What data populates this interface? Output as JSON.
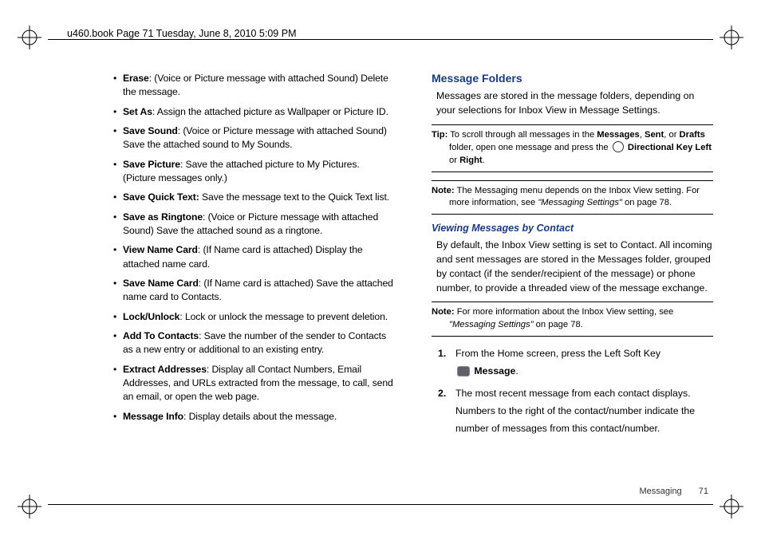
{
  "meta_header": "u460.book  Page 71  Tuesday, June 8, 2010  5:09 PM",
  "left": {
    "items": [
      {
        "term": "Erase",
        "desc": ": (Voice or Picture message with attached Sound) Delete the message."
      },
      {
        "term": "Set As",
        "desc": ": Assign the attached picture as Wallpaper or Picture ID."
      },
      {
        "term": "Save Sound",
        "desc": ": (Voice or Picture message with attached Sound) Save the attached sound to My Sounds."
      },
      {
        "term": "Save Picture",
        "desc": ": Save the attached picture to My Pictures. (Picture messages only.)"
      },
      {
        "term": "Save Quick Text:",
        "desc": " Save the message text to the Quick Text list."
      },
      {
        "term": "Save as Ringtone",
        "desc": ": (Voice or Picture message with attached Sound) Save the attached sound as a ringtone."
      },
      {
        "term": "View Name Card",
        "desc": ": (If Name card is attached) Display the attached name card."
      },
      {
        "term": "Save Name Card",
        "desc": ": (If Name card is attached) Save the attached name card to Contacts."
      },
      {
        "term": "Lock/Unlock",
        "desc": ": Lock or unlock the message to prevent deletion."
      },
      {
        "term": "Add To Contacts",
        "desc": ": Save the number of the sender to Contacts as a new entry or additional to an existing entry."
      },
      {
        "term": "Extract Addresses",
        "desc": ": Display all Contact Numbers, Email Addresses, and URLs extracted from the message, to call, send an email, or open the web page."
      },
      {
        "term": "Message Info",
        "desc": ": Display details about the message."
      }
    ]
  },
  "right": {
    "heading": "Message Folders",
    "intro": "Messages are stored in the message folders, depending on your selections for Inbox View in Message Settings.",
    "tip": {
      "lead": "Tip:",
      "pre": " To scroll through all messages in the ",
      "b1": "Messages",
      "c1": ", ",
      "b2": "Sent",
      "c2": ", or ",
      "b3": "Drafts",
      "mid": " folder, open one message and press the ",
      "b4": "Directional Key Left",
      "c3": " or ",
      "b5": "Right",
      "end": "."
    },
    "note1": {
      "lead": "Note:",
      "text": " The Messaging menu depends on the Inbox View setting. For more information, see ",
      "ref": "\"Messaging Settings\"",
      "tail": " on page 78."
    },
    "sub1": "Viewing Messages by Contact",
    "p1": "By default, the Inbox View setting is set to Contact. All incoming and sent messages are stored in the Messages folder, grouped by contact (if the sender/recipient of the message) or phone number, to provide a threaded view of the message exchange.",
    "note2": {
      "lead": "Note:",
      "text": " For more information about the Inbox View setting, see ",
      "ref": "\"Messaging Settings\"",
      "tail": " on page 78."
    },
    "steps": {
      "s1a": "From the Home screen, press the Left Soft Key ",
      "s1b": "Message",
      "s1c": ".",
      "s2": "The most recent message from each contact displays. Numbers to the right of the contact/number indicate the number of messages from this contact/number."
    }
  },
  "footer": {
    "section": "Messaging",
    "page": "71"
  }
}
